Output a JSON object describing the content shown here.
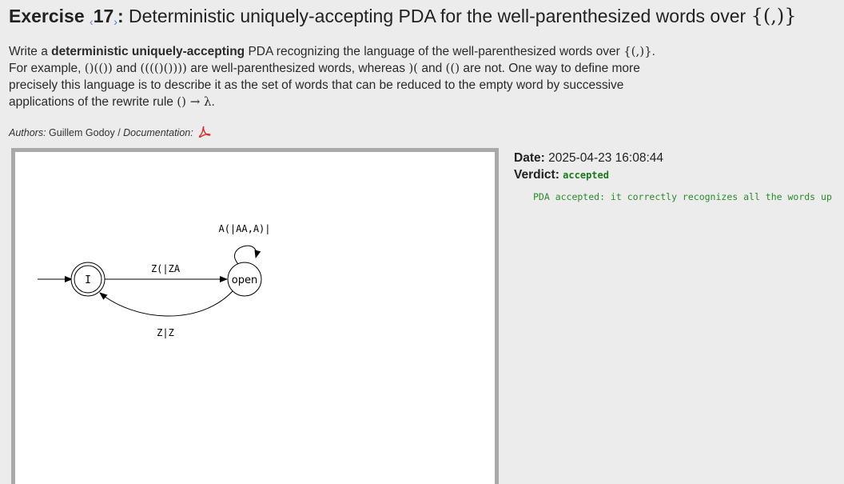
{
  "exercise": {
    "word": "Exercise",
    "prev_glyph": "‹",
    "number": "17",
    "next_glyph": "›",
    "colon": ":",
    "title": "Deterministic uniquely-accepting PDA for the well-parenthesized words over",
    "alphabet": "{(,)}"
  },
  "description": {
    "p1": "Write a ",
    "bold": "deterministic uniquely-accepting",
    "p2": " PDA recognizing the language of the well-parenthesized words over",
    "alphabet": "{(,)}",
    "p3": ". For example, ",
    "ex1": "()(())",
    "and1": " and ",
    "ex2": "(((()())))",
    "p4": " are well-parenthesized words, whereas ",
    "ex3": ")(",
    "and2": " and ",
    "ex4": "(()",
    "p5": " are not. One way to define more precisely this language is to describe it as the set of words that can be reduced to the empty word by successive applications of the rewrite rule ",
    "rule": "() → λ",
    "p6": "."
  },
  "authors": {
    "label": "Authors:",
    "names": "Guillem Godoy",
    "sep": " / ",
    "doc_label": "Documentation:",
    "pdf_icon": "pdf-icon"
  },
  "submission": {
    "date_label": "Date:",
    "date": "2025-04-23 16:08:44",
    "verdict_label": "Verdict:",
    "verdict": "accepted",
    "verdict_color": "#1a7a1a",
    "feedback": "PDA accepted: it correctly recognizes all the words up"
  },
  "automaton": {
    "states": [
      {
        "id": "I",
        "label": "I",
        "initial": true,
        "accepting": true
      },
      {
        "id": "open",
        "label": "open",
        "initial": false,
        "accepting": false
      }
    ],
    "transitions": [
      {
        "from": "open",
        "to": "open",
        "label": "A(|AA,A)|"
      },
      {
        "from": "I",
        "to": "open",
        "label": "Z(|ZA"
      },
      {
        "from": "open",
        "to": "I",
        "label": "Z|Z"
      }
    ]
  }
}
